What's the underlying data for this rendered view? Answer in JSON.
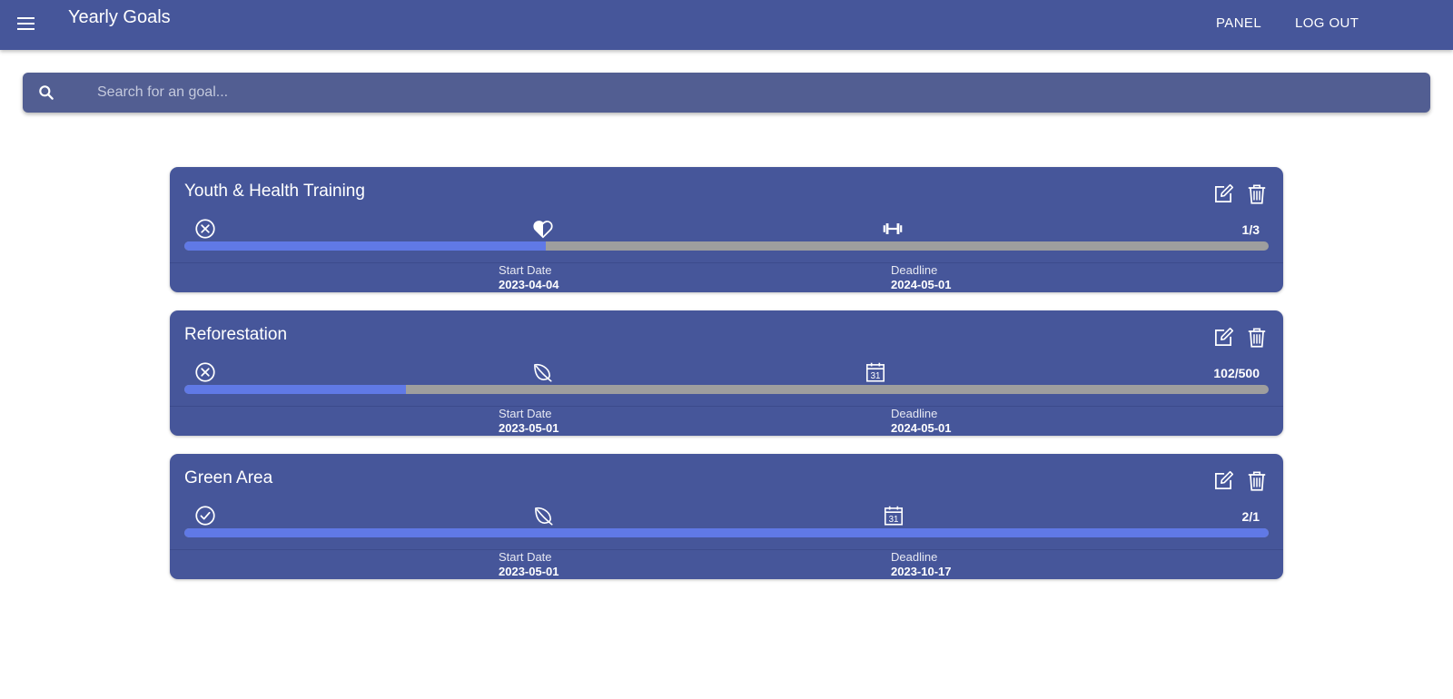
{
  "app": {
    "title": "Yearly Goals",
    "nav": {
      "panel": "PANEL",
      "logout": "LOG OUT"
    }
  },
  "search": {
    "placeholder": "Search for an goal..."
  },
  "labels": {
    "start_date": "Start Date",
    "deadline": "Deadline"
  },
  "colors": {
    "primary": "#46569a",
    "progress": "#6079e6",
    "track": "#9e9e9e",
    "search": "#525e92"
  },
  "goals": [
    {
      "title": "Youth & Health Training",
      "status_icon": "x-circle-icon",
      "category_icon": "heart-icon",
      "activity_icon": "dumbbell-icon",
      "count": "1/3",
      "progress": 0.333,
      "start_date": "2023-04-04",
      "deadline": "2024-05-01"
    },
    {
      "title": "Reforestation",
      "status_icon": "x-circle-icon",
      "category_icon": "leaf-icon",
      "activity_icon": "calendar-icon",
      "count": "102/500",
      "progress": 0.204,
      "start_date": "2023-05-01",
      "deadline": "2024-05-01"
    },
    {
      "title": "Green Area",
      "status_icon": "check-circle-icon",
      "category_icon": "leaf-icon",
      "activity_icon": "calendar-icon",
      "count": "2/1",
      "progress": 1.0,
      "start_date": "2023-05-01",
      "deadline": "2023-10-17"
    }
  ]
}
